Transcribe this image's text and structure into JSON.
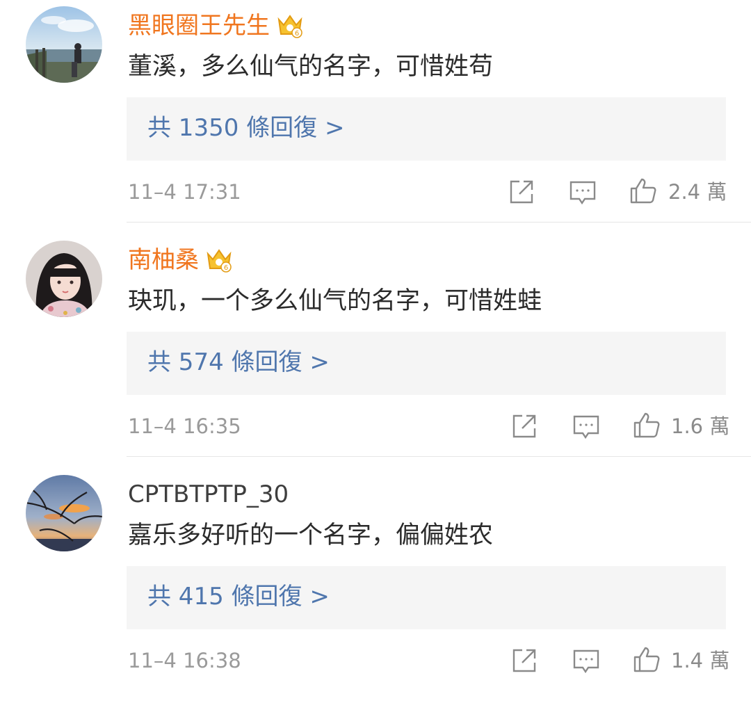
{
  "comments": [
    {
      "username": "黑眼圈王先生",
      "vip": true,
      "vip_level": "6",
      "content": "董溪，多么仙气的名字，可惜姓苟",
      "replies_label": "共 1350 條回復 >",
      "time": "11–4 17:31",
      "likes": "2.4 萬",
      "avatar": "seaside-photo"
    },
    {
      "username": "南柚桑",
      "vip": true,
      "vip_level": "6",
      "content": "玦玑，一个多么仙气的名字，可惜姓蛙",
      "replies_label": "共 574 條回復 >",
      "time": "11–4 16:35",
      "likes": "1.6 萬",
      "avatar": "girl-portrait"
    },
    {
      "username": "CPTBTPTP_30",
      "vip": false,
      "content": "嘉乐多好听的一个名字，偏偏姓农",
      "replies_label": "共 415 條回復 >",
      "time": "11–4 16:38",
      "likes": "1.4 萬",
      "avatar": "sunset-branches"
    }
  ],
  "colors": {
    "vip_name": "#f0761f",
    "normal_name": "#3e3e3e",
    "reply_link": "#4f76ad",
    "reply_bg": "#f5f5f5",
    "meta": "#9a9a9a"
  },
  "icons": {
    "crown": "crown-badge-icon",
    "share": "share-icon",
    "comment": "comment-icon",
    "like": "thumbs-up-icon"
  }
}
